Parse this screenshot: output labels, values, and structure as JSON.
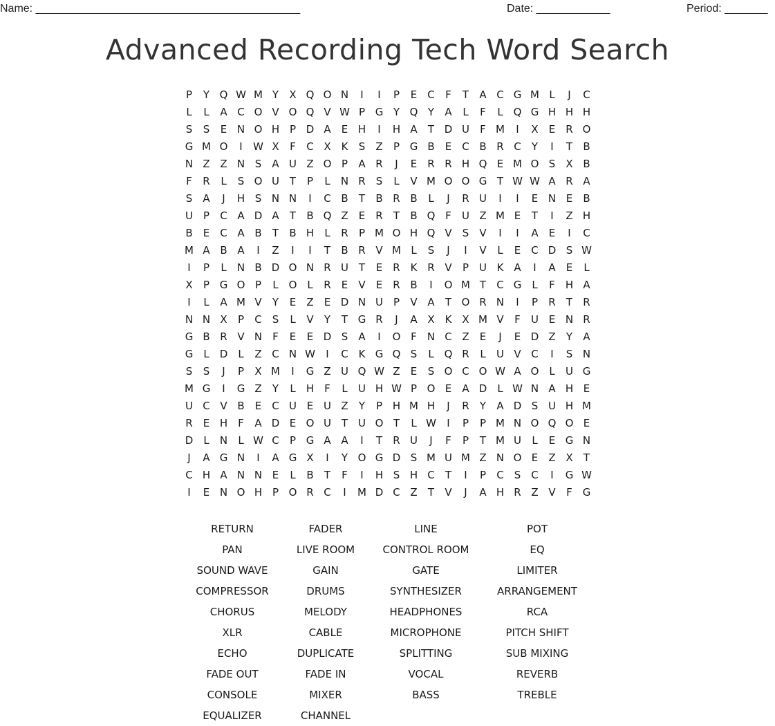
{
  "header": {
    "name_label": "Name: ___________________________________________",
    "date_label": "Date: ____________",
    "period_label": "Period: _______"
  },
  "title": "Advanced Recording Tech Word Search",
  "grid": [
    "PYQWMYXQONIIPECFTACGMLJC",
    "LLACOVOQVWPGYQYALFLQGHHH",
    "SSENOHPDAEHIHATDUFMIXERO",
    "GMOIWXFCXKSZPGBECBRCYITB",
    "NZZNSAUZOPARJERRHQEMOSXB",
    "FRLSOUTPLNRSLVMOOGTWWARA",
    "SAJHSNNICBTBRBLJRUIIENEB",
    "UPCADATBQZERTBQFUZMETIZH",
    "BECABTBHLRPMOHQVSVIIAEIC",
    "MABAIZIITBRVMLSJIVLECDSW",
    "IPLNBDONRUTERKRVPUKAIAEL",
    "XPGOPLOLREVERBIOMTCGLFHA",
    "ILAMVYEZEDNUPVATORNIPRTR",
    "NNXPCSLVYTGRJAXKXMVFUENR",
    "GBRVNFEEDSAIOFNCZEJEDZYA",
    "GLDLZCNWICKGQSLQRLUVCISN",
    "SSJPXMIGZUQWZESOCOWAOLUG",
    "MGIGZYLHFLUHWPOEADLWNAHE",
    "UCVBECUEUZYPHMHJRYADSUHM",
    "REHFADEOUTUOTLWIPPMNOQOE",
    "DLNLWCPGAAITRUJFPTMULEGN",
    "JAGNIAGXIYOGDSMUMZNOEZXT",
    "CHANNELBTFIHSHCTIPCSCIGW",
    "IENOHPORCIMDCZTVJAHRZVFG"
  ],
  "word_list": [
    "RETURN",
    "FADER",
    "LINE",
    "POT",
    "PAN",
    "LIVE ROOM",
    "CONTROL ROOM",
    "EQ",
    "SOUND WAVE",
    "GAIN",
    "GATE",
    "LIMITER",
    "COMPRESSOR",
    "DRUMS",
    "SYNTHESIZER",
    "ARRANGEMENT",
    "CHORUS",
    "MELODY",
    "HEADPHONES",
    "RCA",
    "XLR",
    "CABLE",
    "MICROPHONE",
    "PITCH SHIFT",
    "ECHO",
    "DUPLICATE",
    "SPLITTING",
    "SUB MIXING",
    "FADE OUT",
    "FADE IN",
    "VOCAL",
    "REVERB",
    "CONSOLE",
    "MIXER",
    "BASS",
    "TREBLE",
    "EQUALIZER",
    "CHANNEL"
  ]
}
